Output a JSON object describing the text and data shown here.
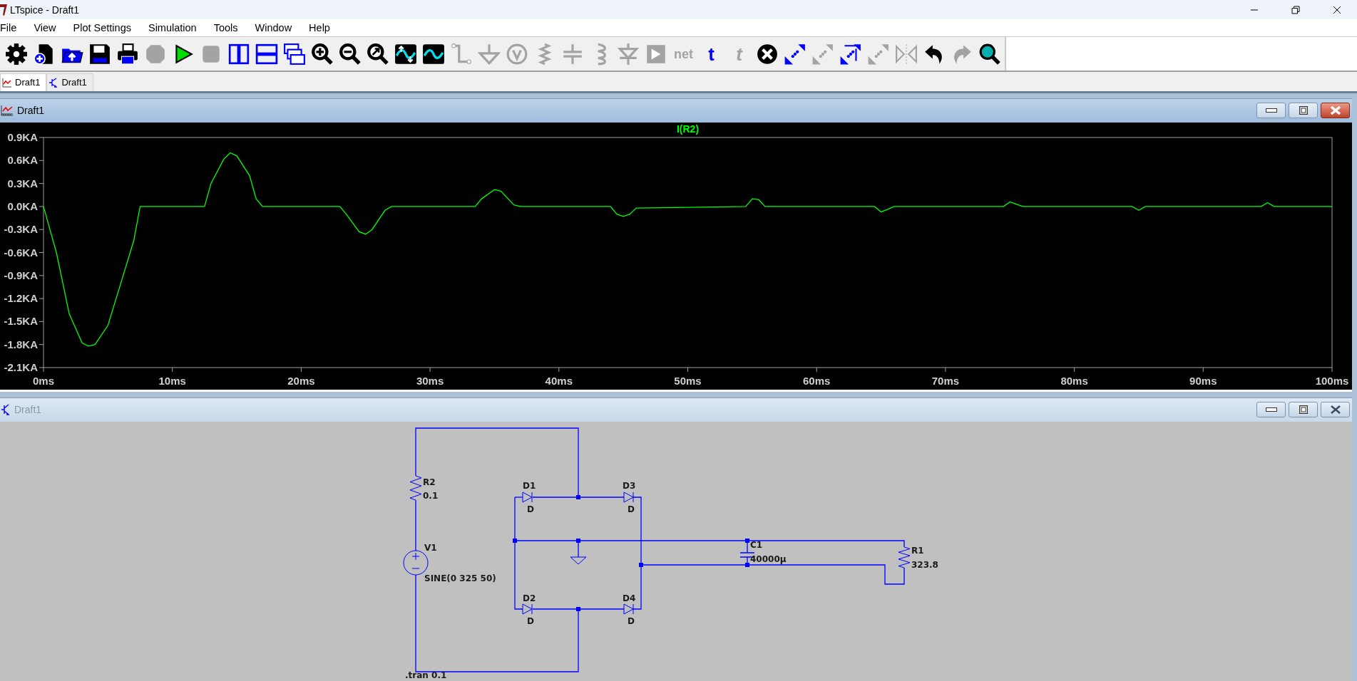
{
  "window": {
    "title": "LTspice - Draft1"
  },
  "menu": [
    "File",
    "View",
    "Plot Settings",
    "Simulation",
    "Tools",
    "Window",
    "Help"
  ],
  "toolbar": [
    {
      "disabled": false
    },
    {
      "disabled": false
    },
    {
      "disabled": false
    },
    {
      "disabled": false
    },
    {
      "disabled": false
    },
    {
      "disabled": true
    },
    {
      "disabled": false
    },
    {
      "disabled": true
    },
    {
      "disabled": false
    },
    {
      "disabled": false
    },
    {
      "disabled": false
    },
    {
      "disabled": false
    },
    {
      "disabled": false
    },
    {
      "disabled": false
    },
    {
      "disabled": false
    },
    {
      "disabled": false
    },
    {
      "disabled": true
    },
    {
      "disabled": true
    },
    {
      "disabled": true
    },
    {
      "disabled": true
    },
    {
      "disabled": true
    },
    {
      "disabled": true
    },
    {
      "disabled": true
    },
    {
      "disabled": true
    },
    {
      "disabled": true,
      "glyph": "net"
    },
    {
      "disabled": false,
      "glyph": "t"
    },
    {
      "disabled": true,
      "glyph": "t"
    },
    {
      "disabled": false
    },
    {
      "disabled": false
    },
    {
      "disabled": true
    },
    {
      "disabled": false
    },
    {
      "disabled": true
    },
    {
      "disabled": true
    },
    {
      "disabled": false
    },
    {
      "disabled": true
    },
    {
      "disabled": false
    }
  ],
  "tabs": [
    {
      "label": "Draft1",
      "kind": "waveform",
      "selected": true
    },
    {
      "label": "Draft1",
      "kind": "schematic",
      "selected": false
    }
  ],
  "plot_window": {
    "title": "Draft1",
    "active": true,
    "chart_data": {
      "type": "line",
      "x": [
        0,
        1,
        2,
        3,
        3.5,
        4,
        5,
        6,
        7,
        7.5,
        12.5,
        13,
        14,
        14.5,
        15,
        16,
        16.5,
        17,
        23,
        23.5,
        24.5,
        25,
        25.5,
        26.5,
        27,
        33.5,
        34,
        35,
        35.5,
        36.5,
        37,
        44,
        44.5,
        45,
        45.5,
        46,
        54.5,
        55,
        55.5,
        56,
        64.5,
        65,
        65.5,
        66,
        74.5,
        75,
        75.5,
        76,
        84.5,
        85,
        85.5,
        94.5,
        95,
        95.5,
        100
      ],
      "series": [
        {
          "name": "I(R2)",
          "color": "#00ff00",
          "values": [
            0,
            -0.6,
            -1.4,
            -1.78,
            -1.82,
            -1.8,
            -1.55,
            -1.0,
            -0.45,
            0,
            0,
            0.3,
            0.62,
            0.7,
            0.66,
            0.4,
            0.1,
            0,
            0,
            -0.1,
            -0.33,
            -0.36,
            -0.3,
            -0.05,
            0,
            0,
            0.1,
            0.22,
            0.2,
            0.02,
            0,
            0,
            -0.1,
            -0.13,
            -0.1,
            -0.02,
            0,
            0.1,
            0.09,
            0,
            0,
            -0.07,
            -0.04,
            0,
            0,
            0.06,
            0.03,
            0,
            0,
            -0.05,
            0,
            0,
            0.05,
            0,
            0
          ]
        }
      ],
      "xlim": [
        0,
        100
      ],
      "ylim": [
        -2.1,
        0.9
      ],
      "xticks": [
        {
          "value": 0,
          "label": "0ms"
        },
        {
          "value": 10,
          "label": "10ms"
        },
        {
          "value": 20,
          "label": "20ms"
        },
        {
          "value": 30,
          "label": "30ms"
        },
        {
          "value": 40,
          "label": "40ms"
        },
        {
          "value": 50,
          "label": "50ms"
        },
        {
          "value": 60,
          "label": "60ms"
        },
        {
          "value": 70,
          "label": "70ms"
        },
        {
          "value": 80,
          "label": "80ms"
        },
        {
          "value": 90,
          "label": "90ms"
        },
        {
          "value": 100,
          "label": "100ms"
        }
      ],
      "yticks": [
        {
          "value": 0.9,
          "label": "0.9KA"
        },
        {
          "value": 0.6,
          "label": "0.6KA"
        },
        {
          "value": 0.3,
          "label": "0.3KA"
        },
        {
          "value": 0,
          "label": "0.0KA"
        },
        {
          "value": -0.3,
          "label": "-0.3KA"
        },
        {
          "value": -0.6,
          "label": "-0.6KA"
        },
        {
          "value": -0.9,
          "label": "-0.9KA"
        },
        {
          "value": -1.2,
          "label": "-1.2KA"
        },
        {
          "value": -1.5,
          "label": "-1.5KA"
        },
        {
          "value": -1.8,
          "label": "-1.8KA"
        },
        {
          "value": -2.1,
          "label": "-2.1KA"
        }
      ]
    }
  },
  "schematic_window": {
    "title": "Draft1",
    "active": false,
    "components": [
      {
        "ref": "R2",
        "value": "0.1"
      },
      {
        "ref": "V1",
        "value": "SINE(0 325 50)"
      },
      {
        "ref": "D1",
        "value": "D"
      },
      {
        "ref": "D3",
        "value": "D"
      },
      {
        "ref": "D2",
        "value": "D"
      },
      {
        "ref": "D4",
        "value": "D"
      },
      {
        "ref": "C1",
        "value": "40000µ"
      },
      {
        "ref": "R1",
        "value": "323.8"
      }
    ],
    "directive": ".tran 0.1"
  }
}
